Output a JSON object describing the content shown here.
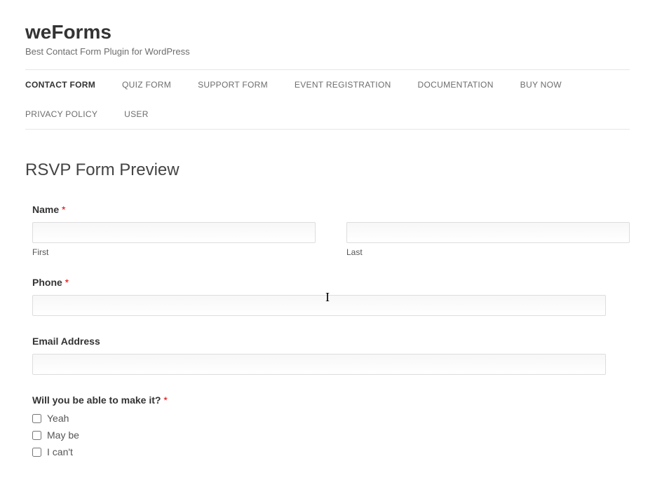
{
  "header": {
    "site_title": "weForms",
    "tagline": "Best Contact Form Plugin for WordPress"
  },
  "nav": {
    "items": [
      {
        "label": "CONTACT FORM",
        "active": true
      },
      {
        "label": "QUIZ FORM",
        "active": false
      },
      {
        "label": "SUPPORT FORM",
        "active": false
      },
      {
        "label": "EVENT REGISTRATION",
        "active": false
      },
      {
        "label": "DOCUMENTATION",
        "active": false
      },
      {
        "label": "BUY NOW",
        "active": false
      },
      {
        "label": "PRIVACY POLICY",
        "active": false
      },
      {
        "label": "USER",
        "active": false
      }
    ]
  },
  "page": {
    "heading": "RSVP Form Preview"
  },
  "form": {
    "name": {
      "label": "Name",
      "required_mark": "*",
      "first_value": "",
      "first_sublabel": "First",
      "last_value": "",
      "last_sublabel": "Last"
    },
    "phone": {
      "label": "Phone",
      "required_mark": "*",
      "value": ""
    },
    "email": {
      "label": "Email Address",
      "value": ""
    },
    "attend": {
      "label": "Will you be able to make it?",
      "required_mark": "*",
      "options": [
        {
          "label": "Yeah",
          "checked": false
        },
        {
          "label": "May be",
          "checked": false
        },
        {
          "label": "I can't",
          "checked": false
        }
      ]
    }
  }
}
